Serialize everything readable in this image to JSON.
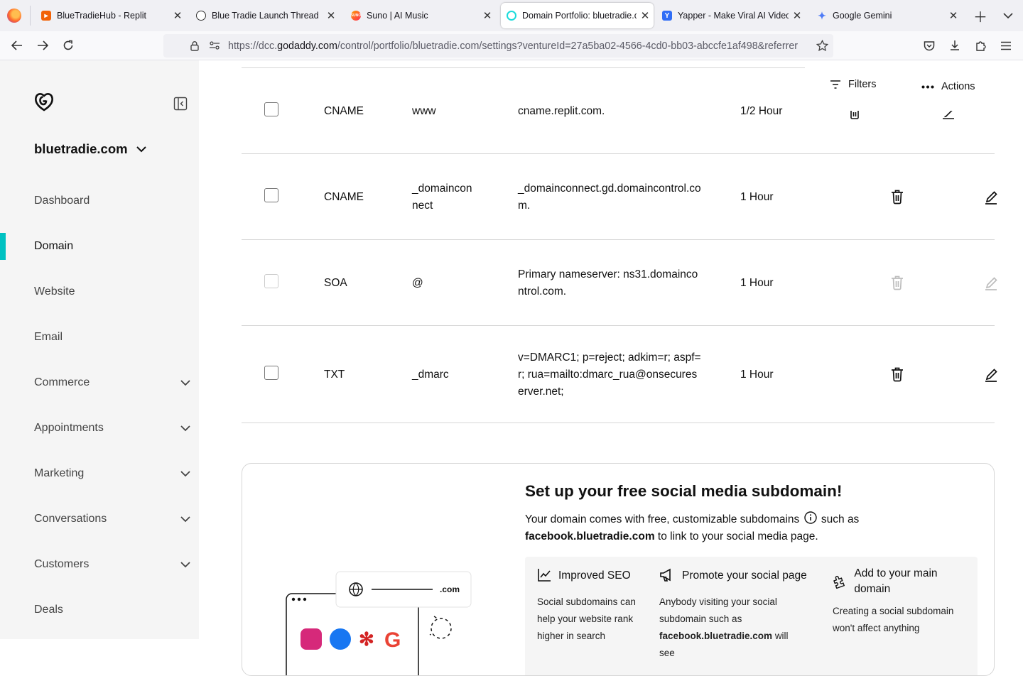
{
  "browser": {
    "tabs": [
      {
        "title": "BlueTradieHub - Replit",
        "favicon": "replit-icon"
      },
      {
        "title": "Blue Tradie Launch Thread",
        "favicon": "chatgpt-icon"
      },
      {
        "title": "Suno | AI Music",
        "favicon": "suno-icon"
      },
      {
        "title": "Domain Portfolio: bluetradie.com",
        "favicon": "godaddy-icon"
      },
      {
        "title": "Yapper - Make Viral AI Videos",
        "favicon": "yapper-icon"
      },
      {
        "title": "Google Gemini",
        "favicon": "gemini-icon"
      }
    ],
    "url_prefix": "https://dcc.",
    "url_host": "godaddy.com",
    "url_rest": "/control/portfolio/bluetradie.com/settings?ventureId=27a5ba02-4566-4cd0-bb03-abccfe1af498&referrer"
  },
  "sidebar": {
    "domain": "bluetradie.com",
    "items": [
      {
        "label": "Dashboard",
        "expandable": false
      },
      {
        "label": "Domain",
        "expandable": false,
        "active": true
      },
      {
        "label": "Website",
        "expandable": false
      },
      {
        "label": "Email",
        "expandable": false
      },
      {
        "label": "Commerce",
        "expandable": true
      },
      {
        "label": "Appointments",
        "expandable": true
      },
      {
        "label": "Marketing",
        "expandable": true
      },
      {
        "label": "Conversations",
        "expandable": true
      },
      {
        "label": "Customers",
        "expandable": true
      },
      {
        "label": "Deals",
        "expandable": false
      }
    ]
  },
  "toolbar": {
    "filters_label": "Filters",
    "actions_label": "Actions"
  },
  "dns_records": [
    {
      "type": "CNAME",
      "name": "www",
      "data": "cname.replit.com.",
      "ttl": "1/2 Hour",
      "editable": true
    },
    {
      "type": "CNAME",
      "name": "_domainconnect",
      "data": "_domainconnect.gd.domaincontrol.com.",
      "ttl": "1 Hour",
      "editable": true
    },
    {
      "type": "SOA",
      "name": "@",
      "data": "Primary nameserver: ns31.domaincontrol.com.",
      "ttl": "1 Hour",
      "editable": false
    },
    {
      "type": "TXT",
      "name": "_dmarc",
      "data": "v=DMARC1; p=reject; adkim=r; aspf=r; rua=mailto:dmarc_rua@onsecureserver.net;",
      "ttl": "1 Hour",
      "editable": true
    }
  ],
  "social_card": {
    "title": "Set up your free social media subdomain!",
    "desc_before": "Your domain comes with free, customizable subdomains",
    "desc_after": "such as",
    "desc_bold": "facebook.bluetradie.com",
    "desc_end": "to link to your social media page.",
    "illustration_tld": ".com",
    "benefits": [
      {
        "icon": "chart-line-icon",
        "title": "Improved SEO",
        "text": "Social subdomains can help your website rank higher in search"
      },
      {
        "icon": "megaphone-icon",
        "title": "Promote your social page",
        "text": "Anybody visiting your social subdomain such as",
        "bold": "facebook.bluetradie.com",
        "text_end": "will see"
      },
      {
        "icon": "puzzle-icon",
        "title": "Add to your main domain",
        "text": "Creating a social subdomain won't affect anything"
      }
    ]
  }
}
